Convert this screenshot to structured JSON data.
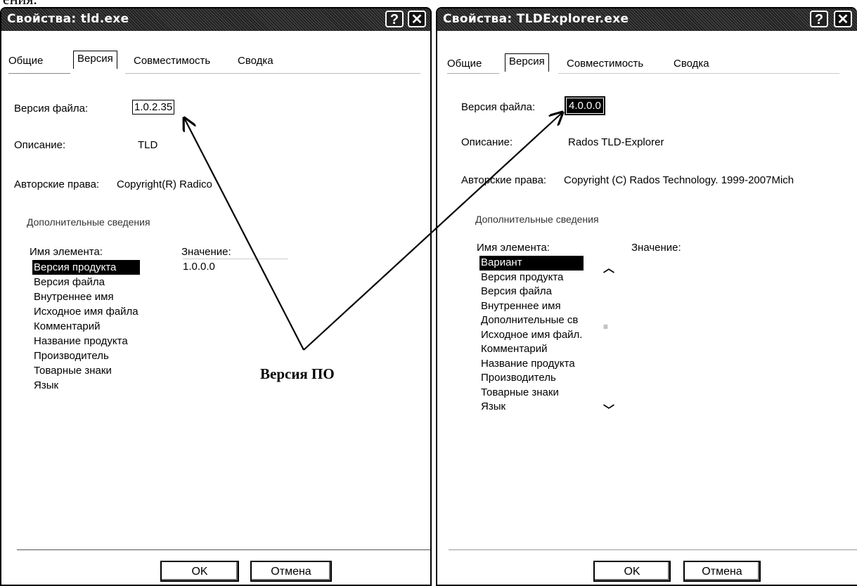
{
  "page_fragment": "ения.",
  "annotation": "Версия ПО",
  "left": {
    "title": "Свойства: tld.exe",
    "help": "?",
    "close": "✕",
    "tabs": [
      "Общие",
      "Версия",
      "Совместимость",
      "Сводка"
    ],
    "file_version_label": "Версия файла:",
    "file_version": "1.0.2.35",
    "description_label": "Описание:",
    "description": "TLD",
    "copyright_label": "Авторские права:",
    "copyright": "Copyright(R) Radico",
    "group_label": "Дополнительные сведения",
    "col_name": "Имя элемента:",
    "col_value": "Значение:",
    "items": [
      "Версия продукта",
      "Версия файла",
      "Внутреннее имя",
      "Исходное имя файла",
      "Комментарий",
      "Название продукта",
      "Производитель",
      "Товарные знаки",
      "Язык"
    ],
    "selected_value": "1.0.0.0",
    "ok": "OK",
    "cancel": "Отмена"
  },
  "right": {
    "title": "Свойства: TLDExplorer.exe",
    "help": "?",
    "close": "✕",
    "tabs": [
      "Общие",
      "Версия",
      "Совместимость",
      "Сводка"
    ],
    "file_version_label": "Версия файла:",
    "file_version": "4.0.0.0",
    "description_label": "Описание:",
    "description": "Rados TLD-Explorer",
    "copyright_label": "Авторские права:",
    "copyright": "Copyright (C) Rados Technology. 1999-2007Mich",
    "group_label": "Дополнительные сведения",
    "col_name": "Имя элемента:",
    "col_value": "Значение:",
    "items": [
      "Вариант",
      "Версия продукта",
      "Версия файла",
      "Внутреннее имя",
      "Дополнительные св",
      "Исходное имя файл.",
      "Комментарий",
      "Название продукта",
      "Производитель",
      "Товарные знаки",
      "Язык"
    ],
    "ok": "OK",
    "cancel": "Отмена"
  }
}
